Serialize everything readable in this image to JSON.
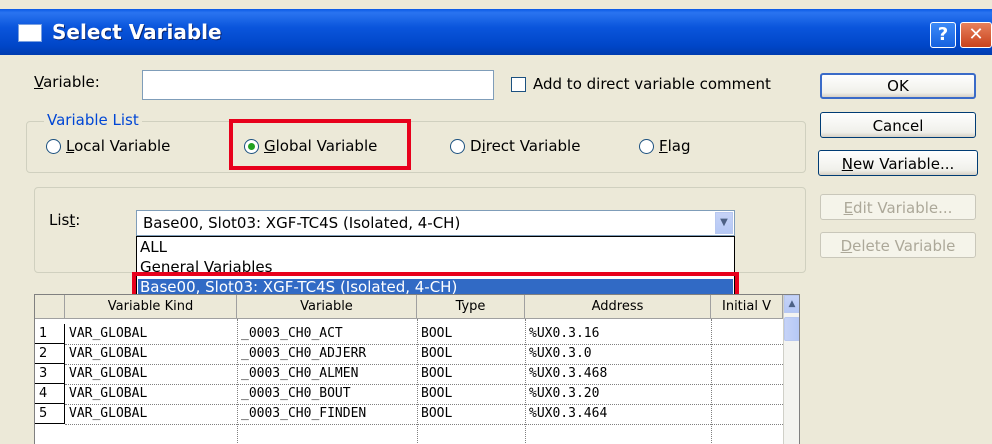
{
  "window": {
    "title": "Select Variable",
    "help_label": "?",
    "close_label": "✕"
  },
  "variable": {
    "label_prefix": "",
    "label_u": "V",
    "label_rest": "ariable:",
    "value": ""
  },
  "add_comment": {
    "label": "Add to direct variable comment",
    "checked": false
  },
  "buttons": {
    "ok": "OK",
    "cancel": "Cancel",
    "new_variable_u": "N",
    "new_variable_rest": "ew Variable...",
    "edit_variable_u": "E",
    "edit_variable_rest": "dit Variable...",
    "delete_variable_u": "D",
    "delete_variable_rest": "elete Variable"
  },
  "variable_list": {
    "legend": "Variable List",
    "local": {
      "u": "L",
      "rest": "ocal Variable"
    },
    "global": {
      "u": "G",
      "rest": "lobal Variable"
    },
    "direct": {
      "pre": "D",
      "u": "i",
      "rest": "rect Variable"
    },
    "flag": {
      "u": "F",
      "rest": "lag"
    },
    "selected": "global"
  },
  "list": {
    "label_pre": "Lis",
    "label_u": "t",
    "label_rest": ":",
    "value": "Base00, Slot03:  XGF-TC4S (Isolated, 4-CH)",
    "options": [
      "ALL",
      "General Variables",
      "Base00, Slot03:  XGF-TC4S (Isolated, 4-CH)"
    ],
    "highlighted_index": 2
  },
  "table": {
    "columns": [
      "Variable Kind",
      "Variable",
      "Type",
      "Address",
      "Initial V"
    ],
    "rows": [
      {
        "num": "1",
        "kind": "VAR_GLOBAL",
        "variable": "_0003_CH0_ACT",
        "type": "BOOL",
        "address": "%UX0.3.16"
      },
      {
        "num": "2",
        "kind": "VAR_GLOBAL",
        "variable": "_0003_CH0_ADJERR",
        "type": "BOOL",
        "address": "%UX0.3.0"
      },
      {
        "num": "3",
        "kind": "VAR_GLOBAL",
        "variable": "_0003_CH0_ALMEN",
        "type": "BOOL",
        "address": "%UX0.3.468"
      },
      {
        "num": "4",
        "kind": "VAR_GLOBAL",
        "variable": "_0003_CH0_BOUT",
        "type": "BOOL",
        "address": "%UX0.3.20"
      },
      {
        "num": "5",
        "kind": "VAR_GLOBAL",
        "variable": "_0003_CH0_FINDEN",
        "type": "BOOL",
        "address": "%UX0.3.464"
      }
    ]
  },
  "colors": {
    "title_bar": "#0a55dc",
    "highlight": "#316ac5",
    "annotation_red": "#e8001c",
    "radio_dot": "#21a121"
  }
}
